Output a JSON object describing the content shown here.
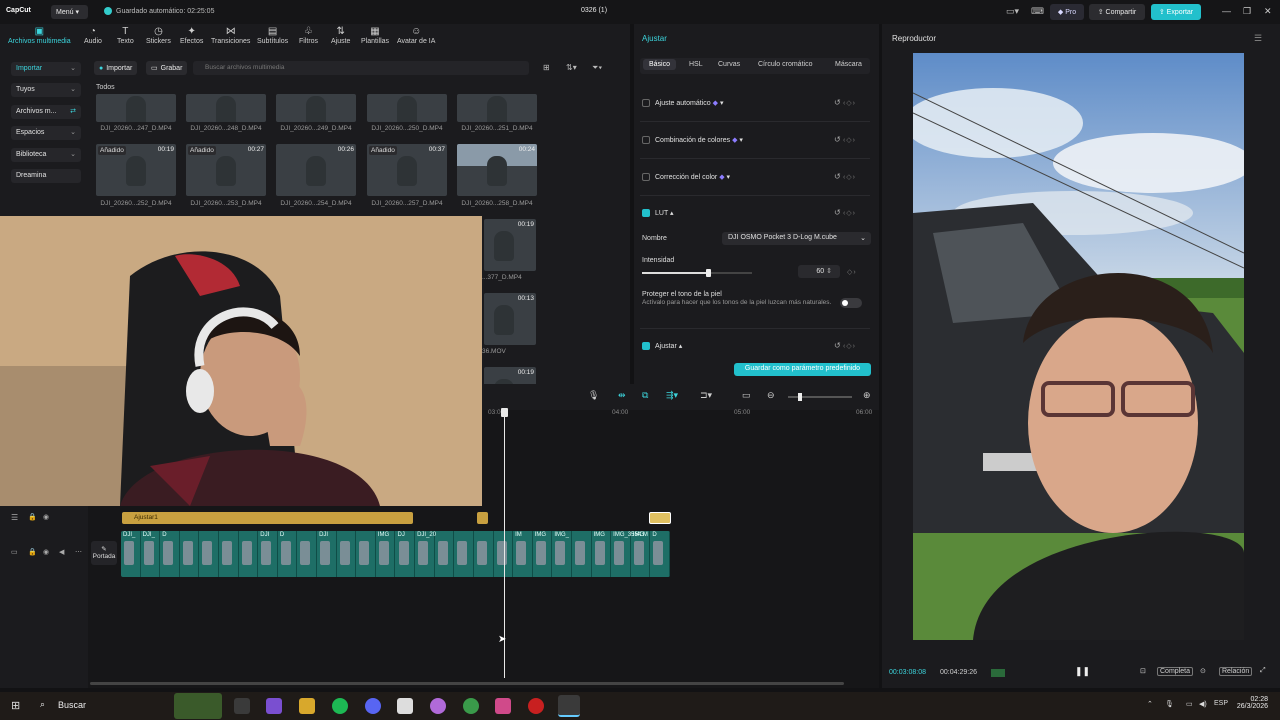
{
  "app": {
    "logo": "CapCut",
    "menu": "Menú",
    "autosave": "Guardado automático: 02:25:05",
    "project": "0326 (1)",
    "pro": "Pro",
    "share": "Compartir",
    "export": "Exportar"
  },
  "toolbar": [
    {
      "label": "Archivos multimedia",
      "icon": "media-icon"
    },
    {
      "label": "Audio",
      "icon": "audio-icon"
    },
    {
      "label": "Texto",
      "icon": "text-icon"
    },
    {
      "label": "Stickers",
      "icon": "sticker-icon"
    },
    {
      "label": "Efectos",
      "icon": "effects-icon"
    },
    {
      "label": "Transiciones",
      "icon": "transition-icon"
    },
    {
      "label": "Subtítulos",
      "icon": "subtitle-icon"
    },
    {
      "label": "Filtros",
      "icon": "filter-icon"
    },
    {
      "label": "Ajuste",
      "icon": "adjust-icon"
    },
    {
      "label": "Plantillas",
      "icon": "template-icon"
    },
    {
      "label": "Avatar de IA",
      "icon": "avatar-icon"
    }
  ],
  "sidebar": [
    {
      "label": "Importar"
    },
    {
      "label": "Tuyos"
    },
    {
      "label": "Archivos m..."
    },
    {
      "label": "Espacios"
    },
    {
      "label": "Biblioteca"
    },
    {
      "label": "Dreamina"
    }
  ],
  "media": {
    "import": "Importar",
    "record": "Grabar",
    "search_placeholder": "Buscar archivos multimedia",
    "all": "Todos",
    "row1": [
      "DJI_20260...247_D.MP4",
      "DJI_20260...248_D.MP4",
      "DJI_20260...249_D.MP4",
      "DJI_20260...250_D.MP4",
      "DJI_20260...251_D.MP4"
    ],
    "row2": [
      {
        "name": "DJI_20260...252_D.MP4",
        "tag": "Añadido",
        "dur": "00:19"
      },
      {
        "name": "DJI_20260...253_D.MP4",
        "tag": "Añadido",
        "dur": "00:27"
      },
      {
        "name": "DJI_20260...254_D.MP4",
        "tag": "",
        "dur": "00:26"
      },
      {
        "name": "DJI_20260...257_D.MP4",
        "tag": "Añadido",
        "dur": "00:37"
      },
      {
        "name": "DJI_20260...258_D.MP4",
        "tag": "",
        "dur": "00:24"
      }
    ],
    "side_visible": [
      {
        "dur": "00:19",
        "name": "...377_D.MP4"
      },
      {
        "dur": "00:13",
        "name": "36.MOV"
      },
      {
        "dur": "00:19",
        "name": ""
      }
    ]
  },
  "adjust": {
    "title": "Ajustar",
    "tabs": [
      "Básico",
      "HSL",
      "Curvas",
      "Círculo cromático",
      "Máscara"
    ],
    "rows": [
      {
        "label": "Ajuste automático"
      },
      {
        "label": "Combinación de colores"
      },
      {
        "label": "Corrección del color"
      },
      {
        "label": "LUT"
      }
    ],
    "name_label": "Nombre",
    "lut_value": "DJI OSMO Pocket 3 D-Log M.cube",
    "intensity_label": "Intensidad",
    "intensity": "60",
    "intensity_fraction": 0.6,
    "skin_label": "Proteger el tono de la piel",
    "skin_desc": "Actívalo para hacer que los tonos de la piel luzcan más naturales.",
    "ajustar_label": "Ajustar",
    "save_preset": "Guardar como parámetro predefinido"
  },
  "player": {
    "title": "Reproductor",
    "current": "00:03:08:08",
    "total": "00:04:29:26",
    "full": "Completa",
    "ratio": "Relación"
  },
  "timeline": {
    "ruler": [
      "03:00",
      "04:00",
      "05:00",
      "06:00"
    ],
    "adjust_clip": "Ajustar1",
    "cover": "Portada",
    "clips": [
      "DJI_",
      "DJI_",
      "D",
      "",
      "",
      "",
      "",
      "DJI",
      "D",
      "",
      "DJI",
      "",
      "",
      "IMG",
      "DJ",
      "DJI_20",
      "",
      "",
      "",
      "",
      "IM",
      "IMG",
      "IMG_",
      "",
      "IMG",
      "IMG_3554.M",
      "IMG",
      "D"
    ]
  },
  "taskbar": {
    "search": "Buscar",
    "lang": "ESP",
    "time": "02:28",
    "date": "26/3/2026"
  }
}
